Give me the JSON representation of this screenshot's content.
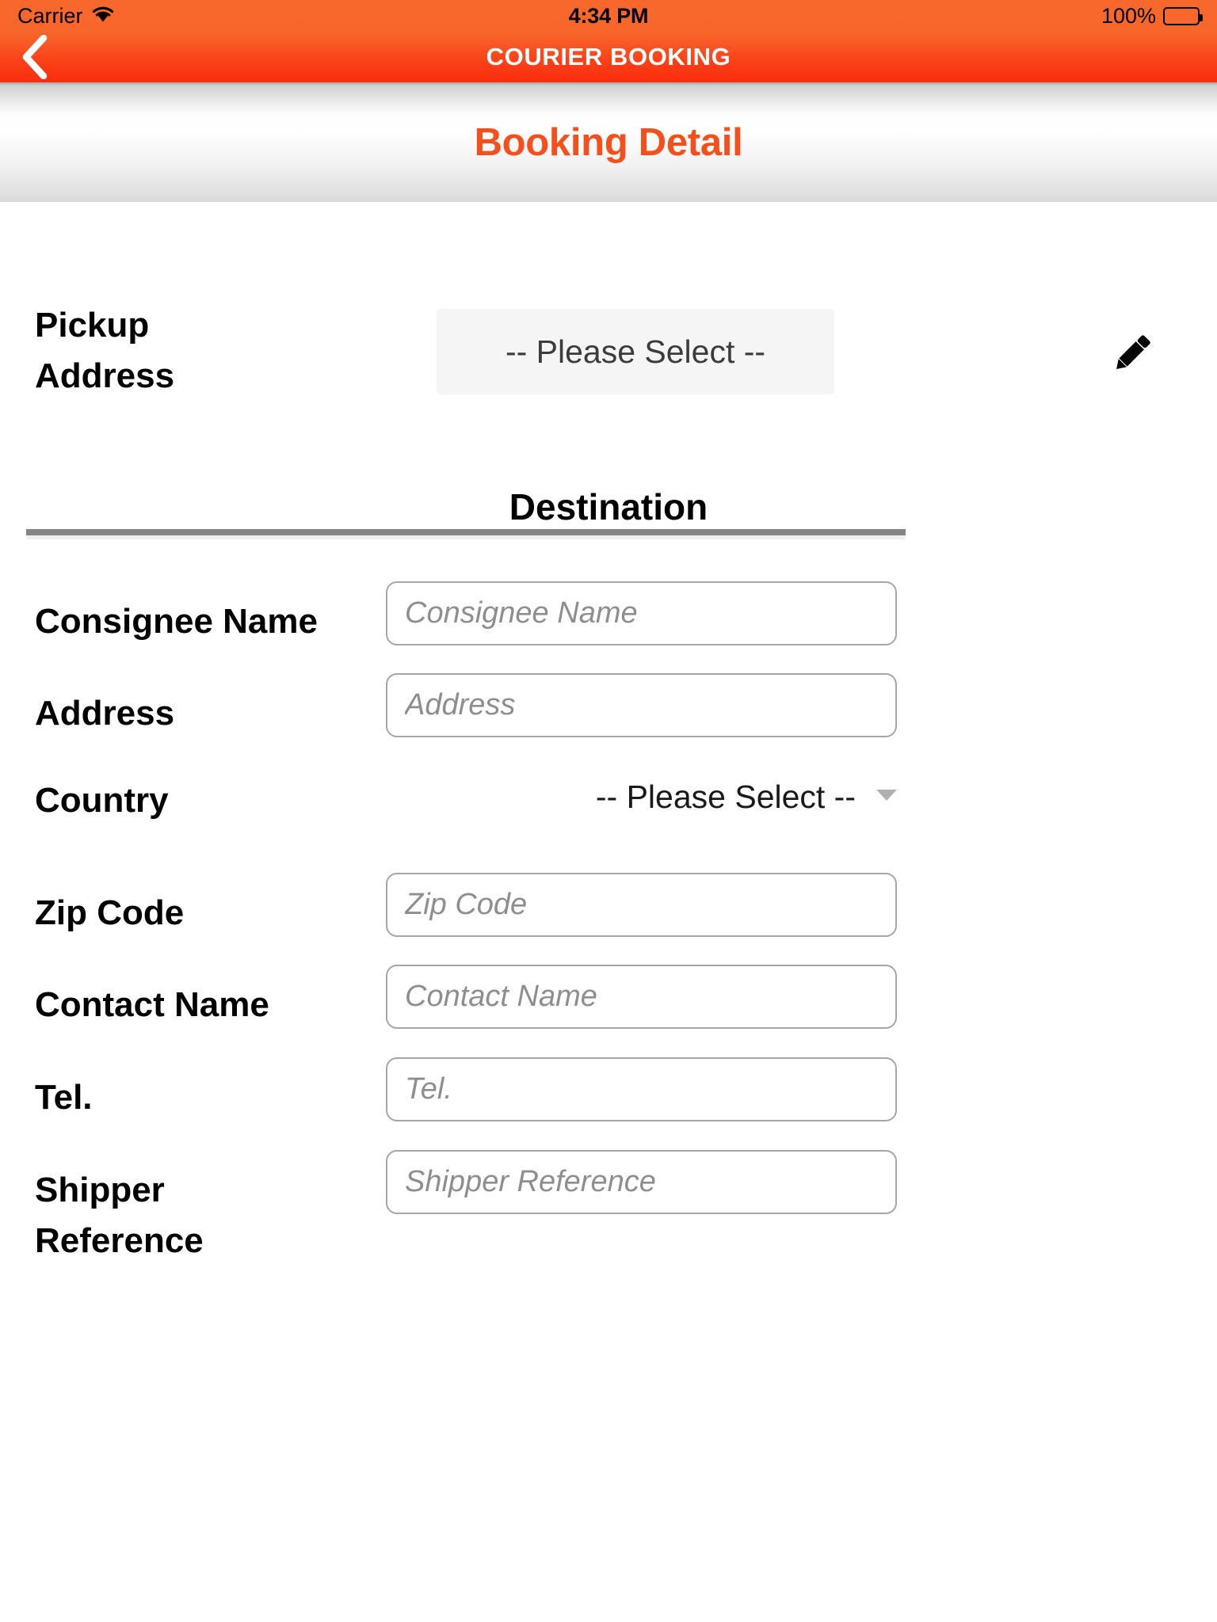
{
  "status_bar": {
    "carrier": "Carrier",
    "time": "4:34 PM",
    "battery_percent": "100%",
    "wifi_icon": "wifi-icon",
    "battery_icon": "battery-icon"
  },
  "nav_bar": {
    "title": "COURIER BOOKING",
    "back_icon": "chevron-left-icon",
    "background_start": "#f8682c",
    "background_end": "#fb2c0e"
  },
  "sub_header": {
    "title": "Booking Detail",
    "title_color": "#f4501e"
  },
  "pickup": {
    "label_line1": "Pickup",
    "label_line2": "Address",
    "select_value": "-- Please Select --",
    "edit_icon": "pencil-icon"
  },
  "destination": {
    "heading": "Destination",
    "fields": [
      {
        "label": "Consignee Name",
        "placeholder": "Consignee Name",
        "value": "",
        "type": "text",
        "name": "consignee-name"
      },
      {
        "label": "Address",
        "placeholder": "Address",
        "value": "",
        "type": "text",
        "name": "address"
      },
      {
        "label": "Country",
        "placeholder": "",
        "value": "-- Please Select --",
        "type": "select",
        "name": "country"
      },
      {
        "label": "Zip Code",
        "placeholder": "Zip Code",
        "value": "",
        "type": "text",
        "name": "zip-code"
      },
      {
        "label": "Contact Name",
        "placeholder": "Contact Name",
        "value": "",
        "type": "text",
        "name": "contact-name"
      },
      {
        "label": "Tel.",
        "placeholder": "Tel.",
        "value": "",
        "type": "text",
        "name": "tel"
      },
      {
        "label": "Shipper Reference",
        "placeholder": "Shipper Reference",
        "value": "",
        "type": "text",
        "name": "shipper-reference"
      }
    ]
  }
}
